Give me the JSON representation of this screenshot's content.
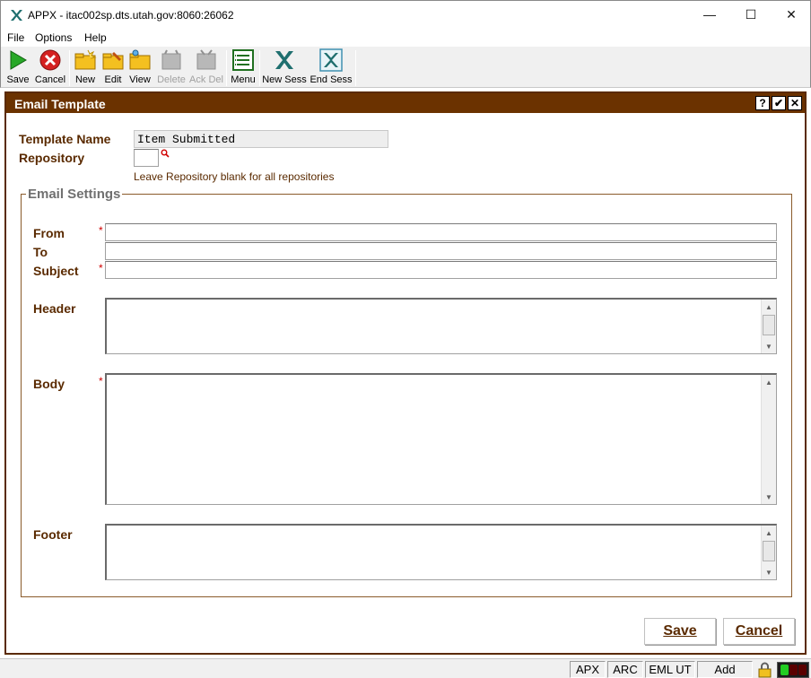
{
  "window": {
    "title": "APPX - itac002sp.dts.utah.gov:8060:26062",
    "minimize_glyph": "—",
    "maximize_glyph": "☐",
    "close_glyph": "✕"
  },
  "menu": [
    "File",
    "Options",
    "Help"
  ],
  "toolbar": [
    {
      "label": "Save",
      "icon": "save-play-icon",
      "enabled": true
    },
    {
      "label": "Cancel",
      "icon": "cancel-icon",
      "enabled": true
    },
    {
      "label": "New",
      "icon": "new-folder-icon",
      "enabled": true
    },
    {
      "label": "Edit",
      "icon": "edit-folder-icon",
      "enabled": true
    },
    {
      "label": "View",
      "icon": "view-folder-icon",
      "enabled": true
    },
    {
      "label": "Delete",
      "icon": "delete-icon",
      "enabled": false
    },
    {
      "label": "Ack Del",
      "icon": "ack-delete-icon",
      "enabled": false
    },
    {
      "label": "Menu",
      "icon": "menu-list-icon",
      "enabled": true
    },
    {
      "label": "New Sess",
      "icon": "new-session-icon",
      "enabled": true
    },
    {
      "label": "End Sess",
      "icon": "end-session-icon",
      "enabled": true
    }
  ],
  "dialog": {
    "title": "Email Template",
    "help_glyph": "?",
    "ok_glyph": "✔",
    "close_glyph": "✕",
    "template_name_label": "Template Name",
    "template_name_value": "Item Submitted",
    "repository_label": "Repository",
    "repository_value": "",
    "repository_hint": "Leave Repository blank for all repositories",
    "email_settings_legend": "Email Settings",
    "required_mark": "*",
    "from_label": "From",
    "from_value": "",
    "to_label": "To",
    "to_value": "",
    "subject_label": "Subject",
    "subject_value": "",
    "header_label": "Header",
    "body_label": "Body",
    "footer_label": "Footer",
    "save_button": "Save",
    "cancel_button": "Cancel"
  },
  "status": {
    "cells": [
      "APX",
      "ARC",
      "EML UT",
      "Add"
    ],
    "led_colors": [
      "#22cc22",
      "#5a0000",
      "#5a0000"
    ]
  },
  "colors": {
    "dialog_header": "#6b3200",
    "label_brown": "#5a2a00",
    "required_red": "#d00000"
  }
}
